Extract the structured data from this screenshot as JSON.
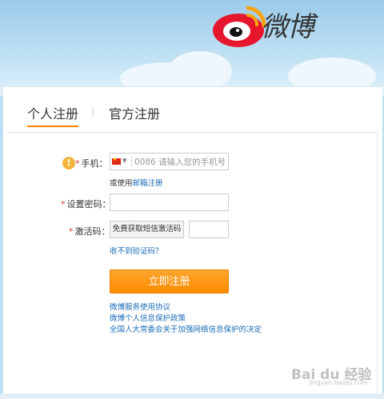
{
  "brand": {
    "name": "微博"
  },
  "tabs": [
    {
      "label": "个人注册",
      "active": true
    },
    {
      "label": "官方注册",
      "active": false
    }
  ],
  "form": {
    "phone_label": "手机：",
    "phone_country_code": "0086",
    "phone_placeholder": "请输入您的手机号",
    "email_prefix": "或使用",
    "email_link": "邮箱注册",
    "password_label": "设置密码：",
    "code_label": "激活码：",
    "sms_button": "免费获取短信激活码",
    "no_code_link": "收不到验证码？",
    "submit_button": "立即注册",
    "required_mark": "*"
  },
  "agreements": [
    "微博服务使用协议",
    "微博个人信息保护政策",
    "全国人大常委会关于加强网络信息保护的决定"
  ],
  "watermark": {
    "text": "Bai du 经验",
    "sub": "jingyan.baidu.com"
  },
  "colors": {
    "accent": "#ff8200",
    "link": "#1a6bb8",
    "required": "#e4393c"
  }
}
